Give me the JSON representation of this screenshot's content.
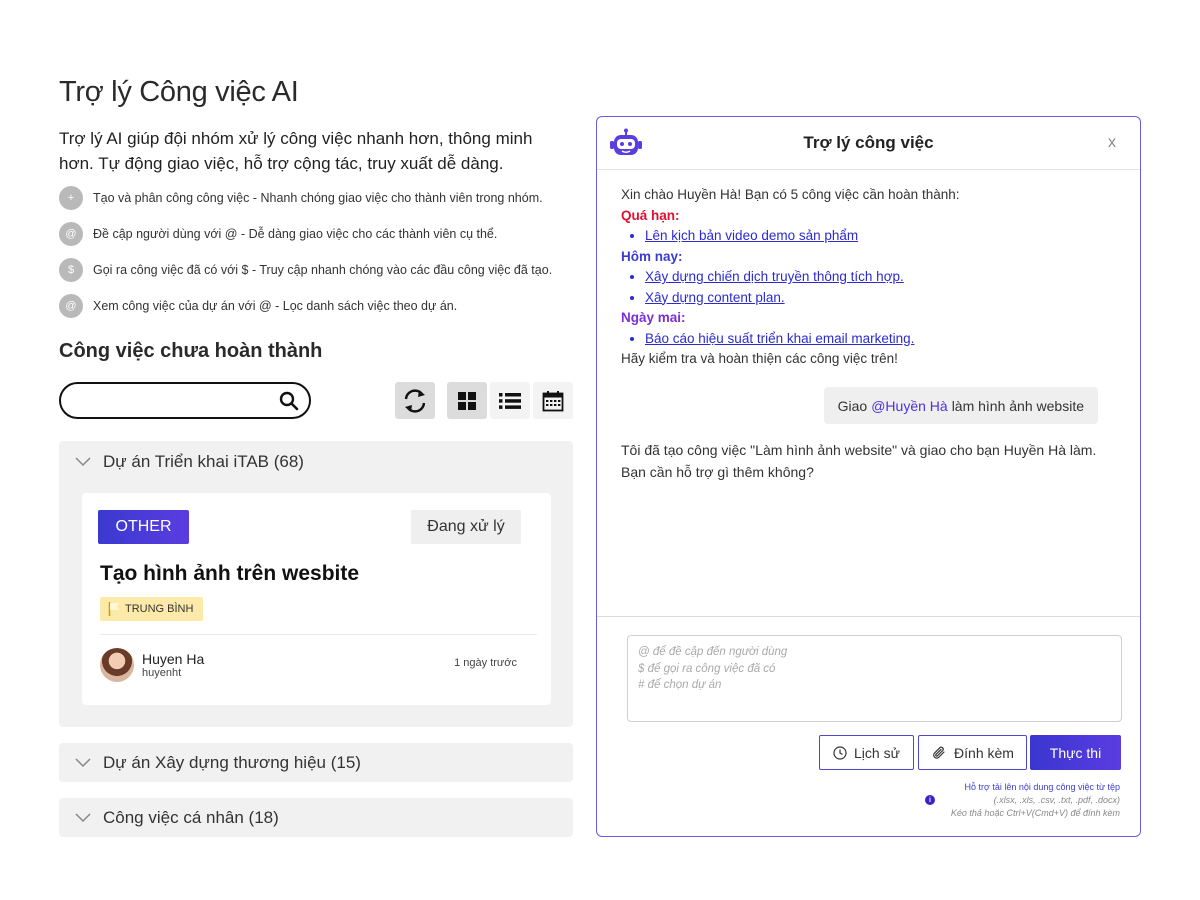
{
  "page": {
    "title": "Trợ lý Công việc AI",
    "description": "Trợ lý AI giúp đội nhóm xử lý công việc nhanh hơn, thông minh hơn. Tự động giao việc, hỗ trợ cộng tác, truy xuất dễ dàng."
  },
  "features": [
    {
      "icon": "+",
      "text": "Tạo và phân công công việc - Nhanh chóng giao việc cho thành viên trong nhóm."
    },
    {
      "icon": "@",
      "text": "Đề cập người dùng với @ - Dễ dàng giao việc cho các thành viên cụ thể."
    },
    {
      "icon": "$",
      "text": "Gọi ra công việc đã có với $ - Truy cập nhanh chóng vào các đầu công việc đã tạo."
    },
    {
      "icon": "@",
      "text": "Xem công việc của dự án với @ - Lọc danh sách việc theo dự án."
    }
  ],
  "tasks_section": {
    "title": "Công việc chưa hoàn thành",
    "search_value": "",
    "groups": [
      {
        "label": "Dự án Triển khai iTAB (68)"
      },
      {
        "label": "Dự án Xây dựng thương hiệu (15)"
      },
      {
        "label": "Công việc cá nhân (18)"
      }
    ],
    "card": {
      "tag": "OTHER",
      "status": "Đang xử lý",
      "title": "Tạo hình ảnh trên wesbite",
      "priority": "TRUNG BÌNH",
      "user_name": "Huyen Ha",
      "user_handle": "huyenht",
      "time": "1 ngày trước"
    }
  },
  "chat": {
    "title": "Trợ lý công việc",
    "close": "x",
    "greeting": "Xin chào Huyền Hà! Bạn có 5 công việc cần hoàn thành:",
    "overdue_label": "Quá hạn:",
    "overdue_items": [
      "Lên kịch bản video demo sản phẩm"
    ],
    "today_label": "Hôm nay:",
    "today_items": [
      "Xây dựng chiến dịch truyền thông tích hợp.",
      "Xây dựng content plan."
    ],
    "tomorrow_label": "Ngày mai:",
    "tomorrow_items": [
      "Báo cáo hiệu suất triển khai email marketing."
    ],
    "closing": "Hãy kiểm tra và hoàn thiện các công việc trên!",
    "user_message": {
      "prefix": "Giao",
      "mention": "@Huyền Hà",
      "rest": "làm hình ảnh website"
    },
    "bot_reply": "Tôi đã tạo công việc \"Làm hình ảnh website\" và giao cho bạn Huyền Hà làm. Bạn cần hỗ trợ gì thêm không?",
    "input_placeholder": "@ để đề cập đến người dùng\n$ để gọi ra công việc đã có\n# để chọn dự án",
    "input_value": "",
    "buttons": {
      "history": "Lịch sử",
      "attach": "Đính kèm",
      "run": "Thực thi"
    },
    "upload_note_1": "Hỗ trợ tải lên nội dung công việc từ tệp",
    "upload_note_2": "(.xlsx, .xls, .csv, .txt, .pdf, .docx)",
    "upload_note_3": "Kéo thả hoặc Ctrl+V(Cmd+V) để đính kèm"
  },
  "colors": {
    "accent": "#4a3ad8",
    "overdue": "#e0102f",
    "today": "#3b3ccf",
    "tomorrow": "#7b2fd8",
    "priority_bg": "#fdeaa8"
  }
}
